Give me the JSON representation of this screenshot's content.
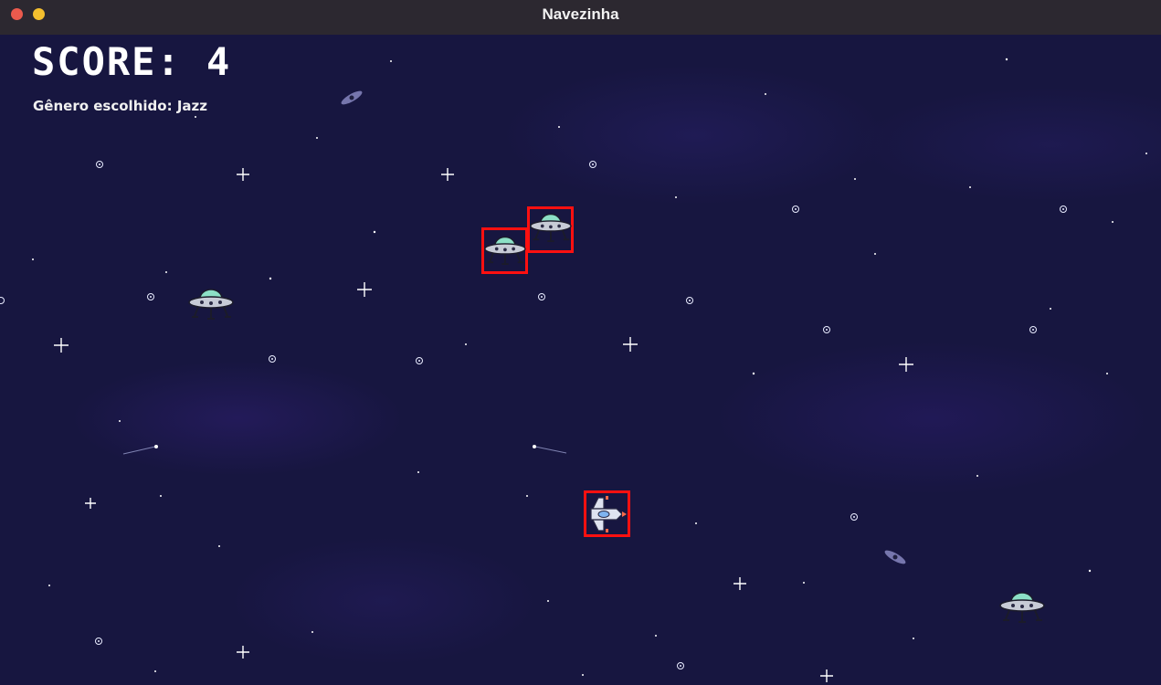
{
  "window": {
    "title": "Navezinha"
  },
  "hud": {
    "score_label": "SCORE:",
    "score": 4,
    "genre_label": "Gênero escolhido:",
    "genre": "Jazz"
  },
  "colors": {
    "background": "#171640",
    "hitbox": "#ff1010",
    "ufo_dome": "#8ce0c6",
    "ufo_body": "#c7cbd6",
    "ship_hull": "#dfe3f0",
    "ship_engine": "#ff6a4a"
  },
  "entities": [
    {
      "type": "ufo",
      "icon": "ufo-icon",
      "hitbox": false
    },
    {
      "type": "ufo",
      "icon": "ufo-icon",
      "hitbox": true
    },
    {
      "type": "ufo",
      "icon": "ufo-icon",
      "hitbox": true
    },
    {
      "type": "ufo",
      "icon": "ufo-icon",
      "hitbox": false
    },
    {
      "type": "player-ship",
      "icon": "spaceship-icon",
      "hitbox": true
    }
  ]
}
